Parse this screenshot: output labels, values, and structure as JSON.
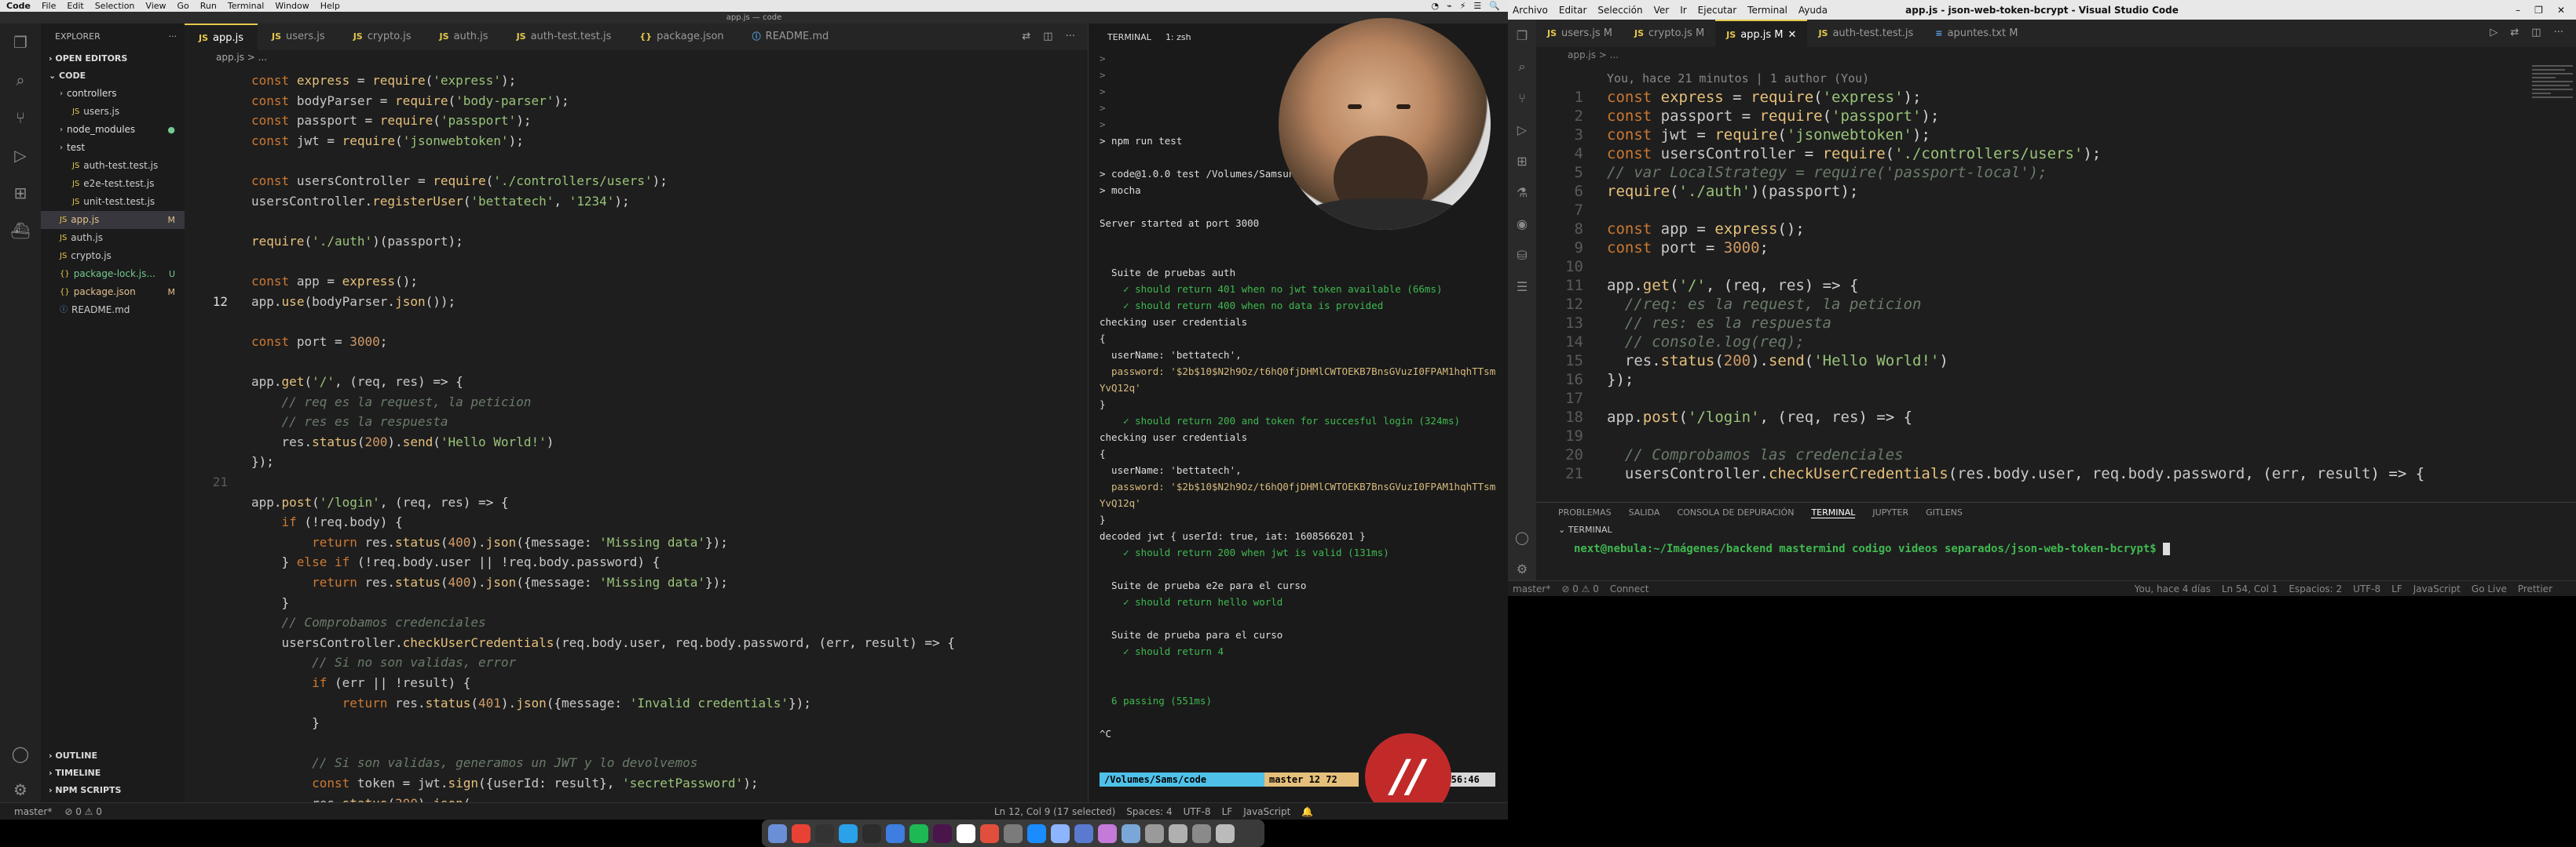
{
  "mac_menubar": {
    "app": "Code",
    "items": [
      "File",
      "Edit",
      "Selection",
      "View",
      "Go",
      "Run",
      "Terminal",
      "Window",
      "Help"
    ],
    "tray": [
      "◔",
      "⌁",
      "⚡",
      "☰",
      "🔍"
    ]
  },
  "left_window": {
    "title": "app.js — code",
    "sidebar": {
      "header": "EXPLORER",
      "open_editors": "OPEN EDITORS",
      "root": "CODE",
      "tree": [
        {
          "label": "controllers",
          "kind": "folder",
          "indent": 1
        },
        {
          "label": "users.js",
          "kind": "js",
          "indent": 2
        },
        {
          "label": "node_modules",
          "kind": "folder",
          "indent": 1,
          "badge": "●"
        },
        {
          "label": "test",
          "kind": "folder",
          "indent": 1
        },
        {
          "label": "auth-test.test.js",
          "kind": "js",
          "indent": 2
        },
        {
          "label": "e2e-test.test.js",
          "kind": "js",
          "indent": 2
        },
        {
          "label": "unit-test.test.js",
          "kind": "js",
          "indent": 2
        },
        {
          "label": "app.js",
          "kind": "js",
          "indent": 1,
          "badge": "M",
          "selected": true
        },
        {
          "label": "auth.js",
          "kind": "js",
          "indent": 1
        },
        {
          "label": "crypto.js",
          "kind": "js",
          "indent": 1
        },
        {
          "label": "package-lock.js...",
          "kind": "json",
          "indent": 1,
          "badge": "U"
        },
        {
          "label": "package.json",
          "kind": "json",
          "indent": 1,
          "badge": "M"
        },
        {
          "label": "README.md",
          "kind": "md",
          "indent": 1
        }
      ],
      "bottom": [
        "OUTLINE",
        "TIMELINE",
        "NPM SCRIPTS"
      ]
    },
    "tabs": [
      "app.js",
      "users.js",
      "crypto.js",
      "auth.js",
      "auth-test.test.js",
      "package.json",
      "README.md"
    ],
    "breadcrumb": "app.js > ...",
    "code_lines": [
      {
        "n": "",
        "t": "const express = require('express');"
      },
      {
        "n": "",
        "t": "const bodyParser = require('body-parser');"
      },
      {
        "n": "",
        "t": "const passport = require('passport');"
      },
      {
        "n": "",
        "t": "const jwt = require('jsonwebtoken');"
      },
      {
        "n": "",
        "t": ""
      },
      {
        "n": "",
        "t": "const usersController = require('./controllers/users');"
      },
      {
        "n": "",
        "t": "usersController.registerUser('bettatech', '1234');"
      },
      {
        "n": "",
        "t": ""
      },
      {
        "n": "",
        "t": "require('./auth')(passport);"
      },
      {
        "n": "",
        "t": ""
      },
      {
        "n": "",
        "t": "const app = express();"
      },
      {
        "n": "12",
        "t": "app.use(bodyParser.json());"
      },
      {
        "n": "",
        "t": ""
      },
      {
        "n": "",
        "t": "const port = 3000;"
      },
      {
        "n": "",
        "t": ""
      },
      {
        "n": "",
        "t": "app.get('/', (req, res) => {"
      },
      {
        "n": "",
        "t": "    // req es la request, la peticion"
      },
      {
        "n": "",
        "t": "    // res es la respuesta"
      },
      {
        "n": "",
        "t": "    res.status(200).send('Hello World!')"
      },
      {
        "n": "",
        "t": "});"
      },
      {
        "n": "21",
        "t": ""
      },
      {
        "n": "",
        "t": "app.post('/login', (req, res) => {"
      },
      {
        "n": "",
        "t": "    if (!req.body) {"
      },
      {
        "n": "",
        "t": "        return res.status(400).json({message: 'Missing data'});"
      },
      {
        "n": "",
        "t": "    } else if (!req.body.user || !req.body.password) {"
      },
      {
        "n": "",
        "t": "        return res.status(400).json({message: 'Missing data'});"
      },
      {
        "n": "",
        "t": "    }"
      },
      {
        "n": "",
        "t": "    // Comprobamos credenciales"
      },
      {
        "n": "",
        "t": "    usersController.checkUserCredentials(req.body.user, req.body.password, (err, result) => {"
      },
      {
        "n": "",
        "t": "        // Si no son validas, error"
      },
      {
        "n": "",
        "t": "        if (err || !result) {"
      },
      {
        "n": "",
        "t": "            return res.status(401).json({message: 'Invalid credentials'});"
      },
      {
        "n": "",
        "t": "        }"
      },
      {
        "n": "",
        "t": ""
      },
      {
        "n": "",
        "t": "        // Si son validas, generamos un JWT y lo devolvemos"
      },
      {
        "n": "",
        "t": "        const token = jwt.sign({userId: result}, 'secretPassword');"
      },
      {
        "n": "",
        "t": "        res.status(200).json("
      }
    ],
    "terminal": {
      "label": "TERMINAL",
      "shell": "1: zsh",
      "lines": [
        {
          "t": ">",
          "cls": "gray"
        },
        {
          "t": ">",
          "cls": "gray"
        },
        {
          "t": ">",
          "cls": "gray"
        },
        {
          "t": ">",
          "cls": "gray"
        },
        {
          "t": ">",
          "cls": "gray"
        },
        {
          "t": "> npm run test",
          "cls": ""
        },
        {
          "t": "",
          "cls": ""
        },
        {
          "t": "> code@1.0.0 test /Volumes/Samsung_T...",
          "cls": ""
        },
        {
          "t": "> mocha",
          "cls": ""
        },
        {
          "t": "",
          "cls": ""
        },
        {
          "t": "Server started at port 3000",
          "cls": ""
        },
        {
          "t": "",
          "cls": ""
        },
        {
          "t": "",
          "cls": ""
        },
        {
          "t": "  Suite de pruebas auth",
          "cls": ""
        },
        {
          "t": "    ✓ should return 401 when no jwt token available (66ms)",
          "cls": "ok"
        },
        {
          "t": "    ✓ should return 400 when no data is provided",
          "cls": "ok"
        },
        {
          "t": "checking user credentials",
          "cls": ""
        },
        {
          "t": "{",
          "cls": ""
        },
        {
          "t": "  userName: 'bettatech',",
          "cls": ""
        },
        {
          "t": "  password: '$2b$10$N2h9Oz/t6hQ0fjDHMlCWTOEKB7BnsGVuzI0FPAM1hqhTTsm",
          "cls": "ylw"
        },
        {
          "t": "YvQ12q'",
          "cls": "ylw"
        },
        {
          "t": "}",
          "cls": ""
        },
        {
          "t": "    ✓ should return 200 and token for succesful login (324ms)",
          "cls": "ok"
        },
        {
          "t": "checking user credentials",
          "cls": ""
        },
        {
          "t": "{",
          "cls": ""
        },
        {
          "t": "  userName: 'bettatech',",
          "cls": ""
        },
        {
          "t": "  password: '$2b$10$N2h9Oz/t6hQ0fjDHMlCWTOEKB7BnsGVuzI0FPAM1hqhTTsm",
          "cls": "ylw"
        },
        {
          "t": "YvQ12q'",
          "cls": "ylw"
        },
        {
          "t": "}",
          "cls": ""
        },
        {
          "t": "decoded jwt { userId: true, iat: 1608566201 }",
          "cls": ""
        },
        {
          "t": "    ✓ should return 200 when jwt is valid (131ms)",
          "cls": "ok"
        },
        {
          "t": "",
          "cls": ""
        },
        {
          "t": "  Suite de prueba e2e para el curso",
          "cls": ""
        },
        {
          "t": "    ✓ should return hello world",
          "cls": "ok"
        },
        {
          "t": "",
          "cls": ""
        },
        {
          "t": "  Suite de prueba para el curso",
          "cls": ""
        },
        {
          "t": "    ✓ should return 4",
          "cls": "ok"
        },
        {
          "t": "",
          "cls": ""
        },
        {
          "t": "",
          "cls": ""
        },
        {
          "t": "  6 passing (551ms)",
          "cls": "ok"
        },
        {
          "t": "",
          "cls": ""
        },
        {
          "t": "^C",
          "cls": ""
        }
      ],
      "prompt_path": "/Volumes/Sams/code",
      "prompt_branch": "master 12 72",
      "time": "16:56:46"
    },
    "status": {
      "branch": "master*",
      "sync": "⊘ 0 ⚠ 0",
      "position": "Ln 12, Col 9 (17 selected)",
      "spaces": "Spaces: 4",
      "encoding": "UTF-8",
      "eol": "LF",
      "lang": "JavaScript"
    },
    "logo_text": "//"
  },
  "right_window": {
    "menu": [
      "Archivo",
      "Editar",
      "Selección",
      "Ver",
      "Ir",
      "Ejecutar",
      "Terminal",
      "Ayuda"
    ],
    "title": "app.js - json-web-token-bcrypt - Visual Studio Code",
    "tabs": [
      {
        "label": "users.js M",
        "active": false
      },
      {
        "label": "crypto.js M",
        "active": false
      },
      {
        "label": "app.js M",
        "active": true
      },
      {
        "label": "auth-test.test.js",
        "active": false
      },
      {
        "label": "apuntes.txt M",
        "active": false
      }
    ],
    "breadcrumb": "app.js > ...",
    "blame": "You, hace 21 minutos | 1 author (You)",
    "code_lines": [
      "const express = require('express');",
      "const passport = require('passport');",
      "const jwt = require('jsonwebtoken');",
      "const usersController = require('./controllers/users');",
      "// var LocalStrategy = require('passport-local');",
      "require('./auth')(passport);",
      "",
      "const app = express();",
      "const port = 3000;",
      "",
      "app.get('/', (req, res) => {",
      "  //req: es la request, la peticion",
      "  // res: es la respuesta",
      "  // console.log(req);",
      "  res.status(200).send('Hello World!')",
      "});",
      "",
      "app.post('/login', (req, res) => {",
      "",
      "  // Comprobamos las credenciales",
      "  usersController.checkUserCredentials(res.body.user, req.body.password, (err, result) => {"
    ],
    "line_numbers": [
      "1",
      "2",
      "3",
      "4",
      "5",
      "6",
      "7",
      "8",
      "9",
      "10",
      "11",
      "12",
      "13",
      "14",
      "15",
      "16",
      "17",
      "18",
      "19",
      "20",
      "21"
    ],
    "panel_tabs": [
      "PROBLEMAS",
      "SALIDA",
      "CONSOLA DE DEPURACIÓN",
      "TERMINAL",
      "JUPYTER",
      "GITLENS"
    ],
    "terminal_label": "TERMINAL",
    "prompt": "next@nebula:~/Imágenes/backend mastermind codigo videos separados/json-web-token-bcrypt$ ",
    "status": {
      "branch": "master*",
      "sync": "⊘ 0 ⚠ 0",
      "connect": "Connect",
      "blame": "You, hace 4 días",
      "pos": "Ln 54, Col 1",
      "spaces": "Espacios: 2",
      "enc": "UTF-8",
      "eol": "LF",
      "lang": "JavaScript",
      "live": "Go Live",
      "pretty": "Prettier"
    }
  },
  "colors": {
    "accent": "#e6c84c",
    "passing": "#3fb950",
    "brand_logo": "#c22a2a"
  }
}
